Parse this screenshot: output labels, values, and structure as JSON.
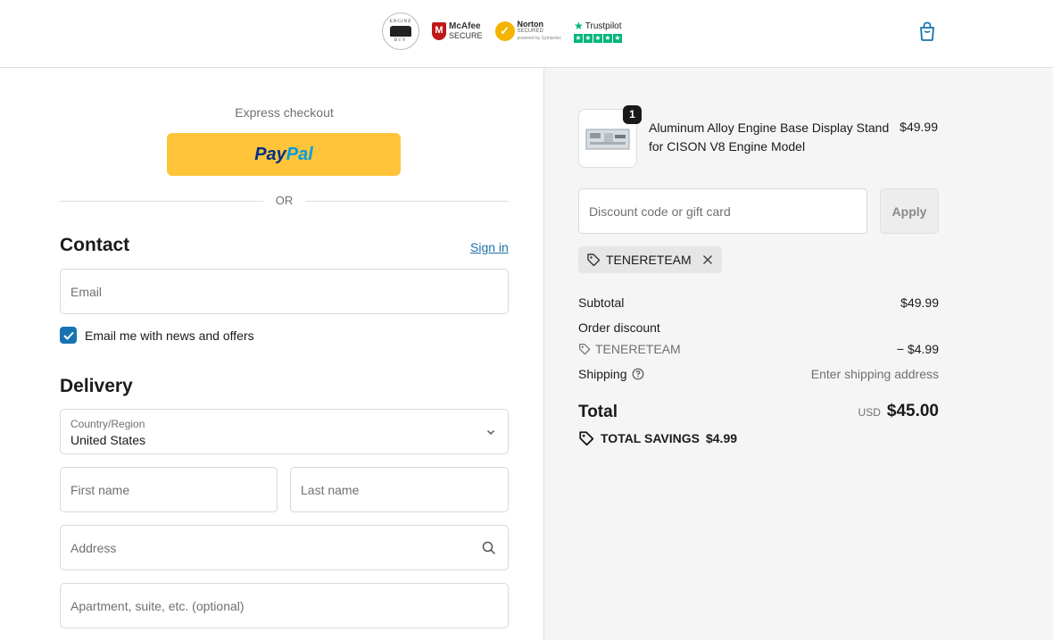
{
  "header": {
    "badges": {
      "engine": {
        "top": "ENGINE",
        "bottom": "DIY"
      },
      "mcafee": {
        "brand": "McAfee",
        "sub": "SECURE"
      },
      "norton": {
        "brand": "Norton",
        "sub": "SECURED",
        "by": "powered by Symantec"
      },
      "trustpilot": {
        "brand": "Trustpilot",
        "stars": 5
      }
    },
    "cart_icon": "shopping-bag-icon"
  },
  "express": {
    "label": "Express checkout",
    "paypal_part1": "Pay",
    "paypal_part2": "Pal",
    "or_label": "OR"
  },
  "contact": {
    "title": "Contact",
    "sign_in": "Sign in",
    "email_placeholder": "Email",
    "newsletter_label": "Email me with news and offers",
    "newsletter_checked": true
  },
  "delivery": {
    "title": "Delivery",
    "country_label": "Country/Region",
    "country_value": "United States",
    "first_name_placeholder": "First name",
    "last_name_placeholder": "Last name",
    "address_placeholder": "Address",
    "apartment_placeholder": "Apartment, suite, etc. (optional)"
  },
  "summary": {
    "product": {
      "name": "Aluminum Alloy Engine Base Display Stand for CISON V8 Engine Model",
      "price": "$49.99",
      "quantity": "1"
    },
    "discount_placeholder": "Discount code or gift card",
    "apply_label": "Apply",
    "applied_code": "TENERETEAM",
    "subtotal_label": "Subtotal",
    "subtotal_value": "$49.99",
    "order_discount_label": "Order discount",
    "discount_code": "TENERETEAM",
    "discount_value": "− $4.99",
    "shipping_label": "Shipping",
    "shipping_value": "Enter shipping address",
    "total_label": "Total",
    "currency": "USD",
    "total_value": "$45.00",
    "savings_label": "TOTAL SAVINGS",
    "savings_value": "$4.99"
  },
  "colors": {
    "accent": "#1773b0",
    "link": "#1f6fa8",
    "paypal_yellow": "#ffc439",
    "summary_bg": "#f5f5f5"
  }
}
